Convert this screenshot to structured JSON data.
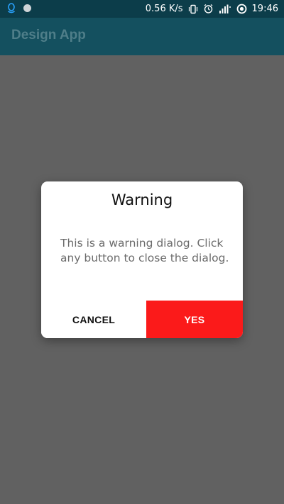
{
  "status_bar": {
    "network_speed": "0.56 K/s",
    "time": "19:46",
    "left_icons": [
      "qq-icon",
      "circle-app-icon"
    ],
    "right_icons": [
      "vibrate-icon",
      "alarm-icon",
      "signal-4g-icon",
      "data-saver-icon"
    ]
  },
  "app_bar": {
    "title": "Design App",
    "background": "#14505f"
  },
  "dialog": {
    "title": "Warning",
    "message": "This is a warning dialog. Click any button to close the dialog.",
    "cancel_label": "CANCEL",
    "confirm_label": "YES",
    "confirm_color": "#fb1a1a"
  },
  "colors": {
    "scrim": "#616161",
    "status_bar": "#0c3d4a"
  }
}
